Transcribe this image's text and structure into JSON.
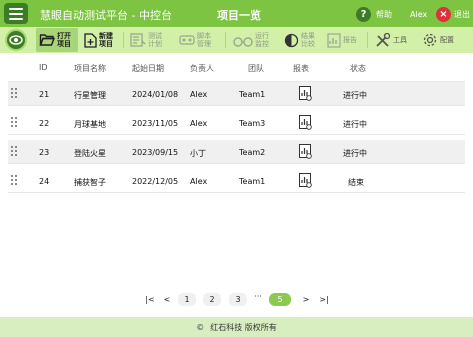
{
  "app": {
    "title": "慧眼自动测试平台 - 中控台",
    "page_title": "项目一览",
    "help_icon": "?",
    "help_label": "帮助",
    "user": "Alex",
    "logout_icon": "×",
    "logout_label": "退出"
  },
  "toolbar": {
    "open_project": "打开\n项目",
    "new_project": "新建\n项目",
    "test_plan": "测试\n计划",
    "script_manage": "脚本\n管理",
    "run_monitor": "运行\n监控",
    "result_compare": "结果\n比较",
    "report": "报告",
    "tools": "工具",
    "config": "配置"
  },
  "table": {
    "headers": {
      "id": "ID",
      "name": "项目名称",
      "start_date": "起始日期",
      "owner": "负责人",
      "team": "团队",
      "report": "报表",
      "status": "状态"
    },
    "rows": [
      {
        "id": "21",
        "name": "行星管理",
        "start_date": "2024/01/08",
        "owner": "Alex",
        "team": "Team1",
        "status": "进行中"
      },
      {
        "id": "22",
        "name": "月球基地",
        "start_date": "2023/11/05",
        "owner": "Alex",
        "team": "Team3",
        "status": "进行中"
      },
      {
        "id": "23",
        "name": "登陆火星",
        "start_date": "2023/09/15",
        "owner": "小丁",
        "team": "Team2",
        "status": "进行中"
      },
      {
        "id": "24",
        "name": "捕获智子",
        "start_date": "2022/12/05",
        "owner": "Alex",
        "team": "Team1",
        "status": "结束"
      }
    ]
  },
  "pagination": {
    "first": "|<",
    "prev": "<",
    "pages": [
      "1",
      "2",
      "3"
    ],
    "ellipsis": "···",
    "current": "5",
    "next": ">",
    "last": ">|"
  },
  "footer": {
    "copyright_icon": "©",
    "text": "红石科技 版权所有"
  }
}
